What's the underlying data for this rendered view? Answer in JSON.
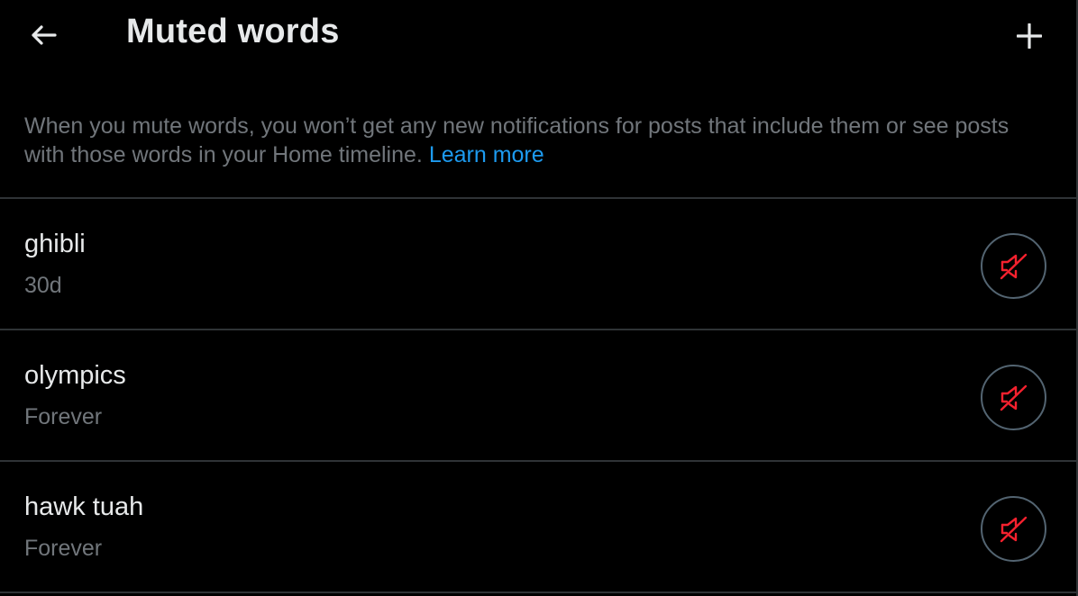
{
  "header": {
    "back_icon": "arrow-left-icon",
    "title": "Muted words",
    "add_icon": "plus-icon"
  },
  "description": {
    "text": "When you mute words, you won’t get any new notifications for posts that include them or see posts with those words in your Home timeline.",
    "link_label": "Learn more"
  },
  "muted_words": [
    {
      "word": "ghibli",
      "duration": "30d",
      "action_icon": "unmute-speaker-icon"
    },
    {
      "word": "olympics",
      "duration": "Forever",
      "action_icon": "unmute-speaker-icon"
    },
    {
      "word": "hawk tuah",
      "duration": "Forever",
      "action_icon": "unmute-speaker-icon"
    }
  ],
  "colors": {
    "background": "#000000",
    "primary_text": "#e7e9ea",
    "secondary_text": "#71767b",
    "link": "#1d9bf0",
    "unmute_icon": "#f4212e",
    "divider": "#2f3336"
  }
}
